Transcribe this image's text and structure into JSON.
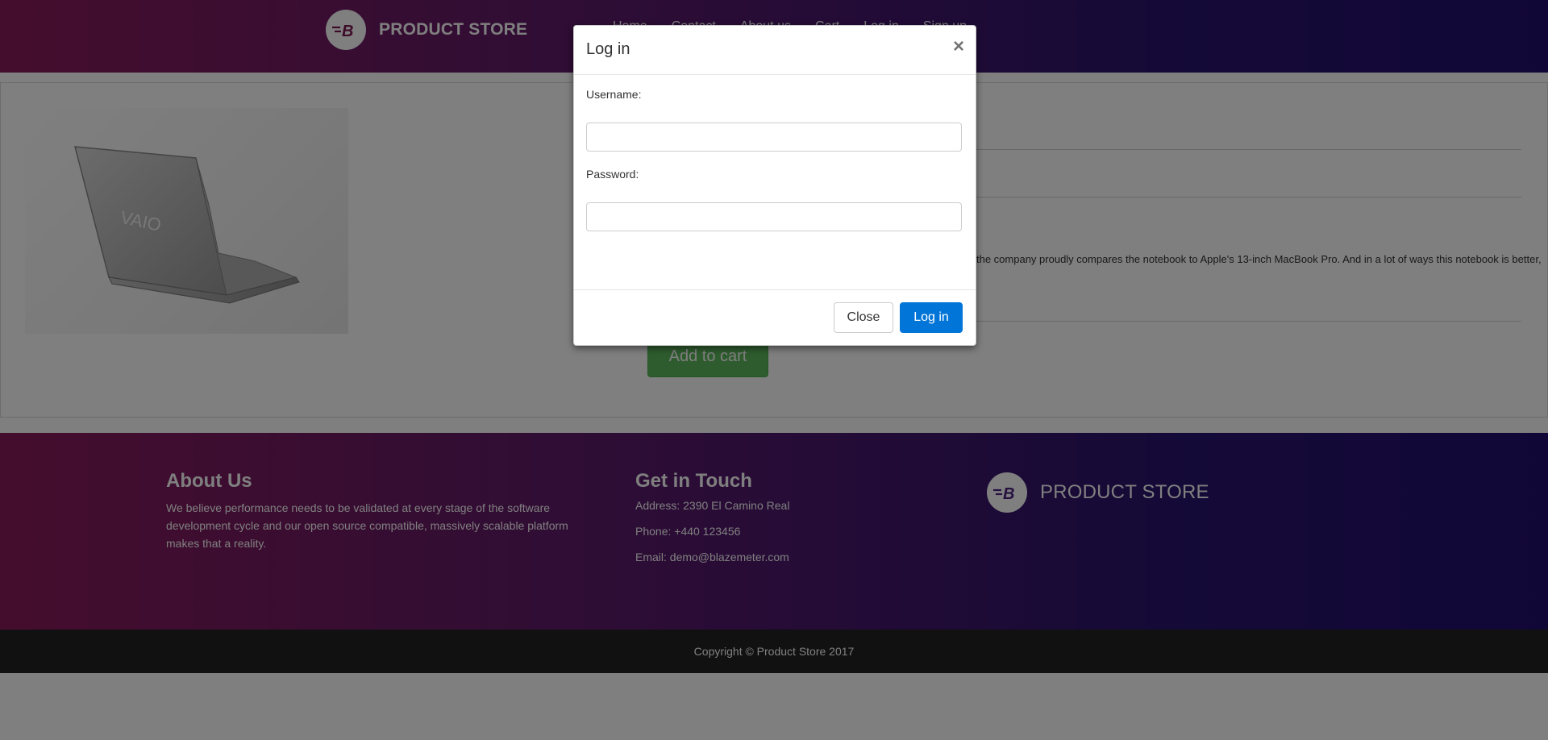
{
  "nav": {
    "brand": "PRODUCT STORE",
    "logo_letter": "B",
    "links": [
      "Home",
      "Contact",
      "About us",
      "Cart",
      "Log in",
      "Sign up"
    ]
  },
  "product": {
    "description_visible": "the company proudly compares the notebook to Apple's 13-inch MacBook Pro. And in a lot of ways this notebook is better,",
    "add_to_cart_label": "Add to cart",
    "image_icon": "laptop-image"
  },
  "footer": {
    "about_title": "About Us",
    "about_text": "We believe performance needs to be validated at every stage of the software development cycle and our open source compatible, massively scalable platform makes that a reality.",
    "touch_title": "Get in Touch",
    "address": "Address: 2390 El Camino Real",
    "phone": "Phone: +440 123456",
    "email": "Email: demo@blazemeter.com",
    "brand": "PRODUCT STORE",
    "copyright": "Copyright © Product Store 2017"
  },
  "modal": {
    "title": "Log in",
    "close_symbol": "×",
    "username_label": "Username:",
    "username_value": "",
    "password_label": "Password:",
    "password_value": "",
    "close_button": "Close",
    "login_button": "Log in"
  },
  "colors": {
    "navbar_start": "#8a1a5a",
    "navbar_end": "#230f6e",
    "primary_button": "#0275d8",
    "success_button": "#5cb85c"
  }
}
